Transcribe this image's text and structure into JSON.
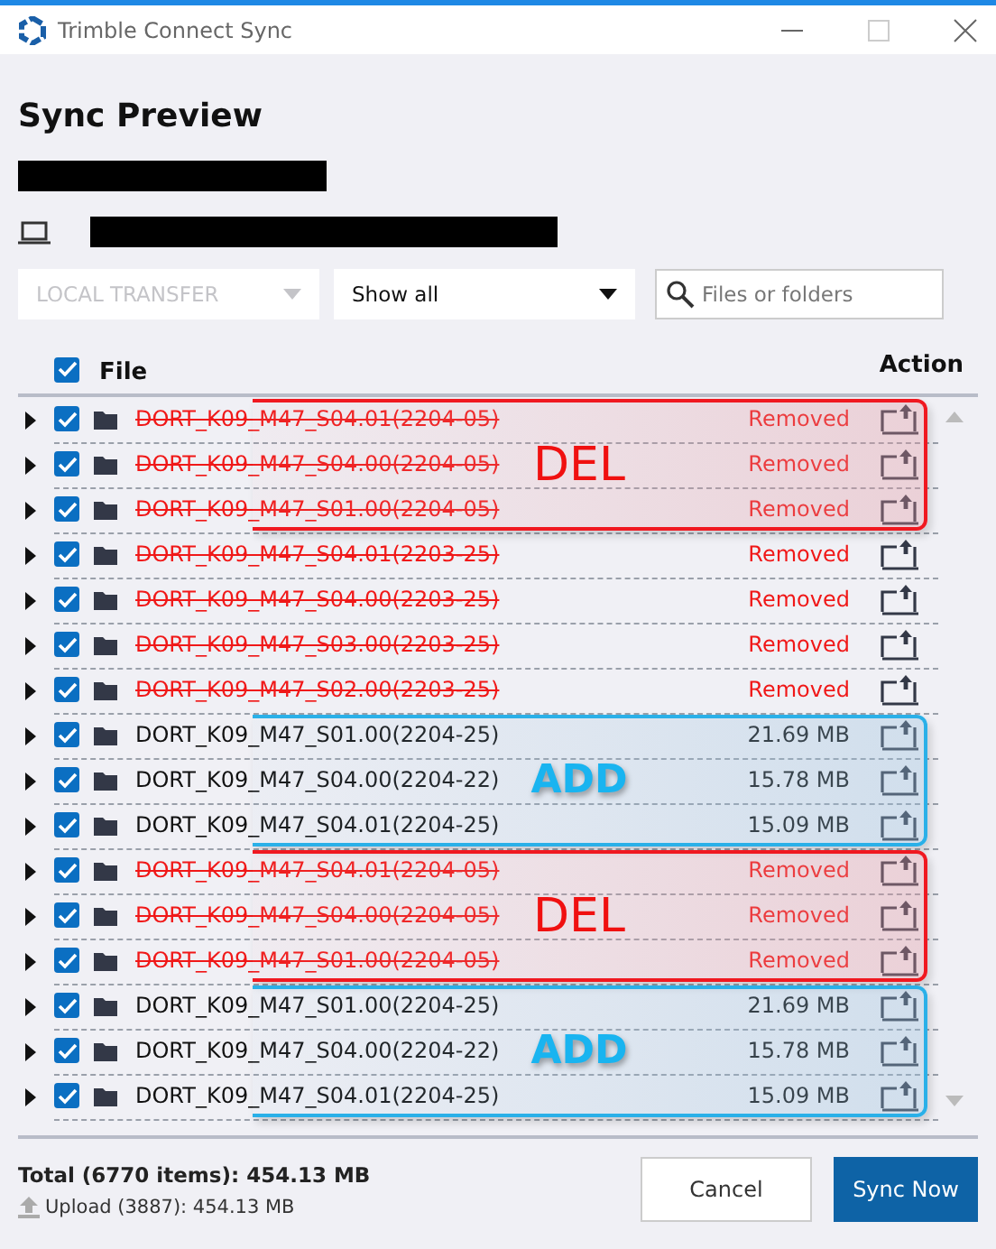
{
  "window": {
    "title": "Trimble Connect Sync"
  },
  "heading": "Sync Preview",
  "filters": {
    "transfer": {
      "label": "LOCAL TRANSFER",
      "disabled": true
    },
    "show": {
      "label": "Show all",
      "disabled": false
    },
    "search": {
      "placeholder": "Files or folders"
    }
  },
  "table": {
    "select_all": true,
    "columns": [
      "File",
      "Action"
    ],
    "groups": [
      {
        "kind": "del",
        "label": "DEL",
        "rows": [
          {
            "name": "DORT_K09_M47_S04.01(2204-05)",
            "status": "Removed",
            "removed": true,
            "checked": true
          },
          {
            "name": "DORT_K09_M47_S04.00(2204-05)",
            "status": "Removed",
            "removed": true,
            "checked": true
          },
          {
            "name": "DORT_K09_M47_S01.00(2204-05)",
            "status": "Removed",
            "removed": true,
            "checked": true
          }
        ]
      },
      {
        "kind": "none",
        "rows": [
          {
            "name": "DORT_K09_M47_S04.01(2203-25)",
            "status": "Removed",
            "removed": true,
            "checked": true
          },
          {
            "name": "DORT_K09_M47_S04.00(2203-25)",
            "status": "Removed",
            "removed": true,
            "checked": true
          },
          {
            "name": "DORT_K09_M47_S03.00(2203-25)",
            "status": "Removed",
            "removed": true,
            "checked": true
          },
          {
            "name": "DORT_K09_M47_S02.00(2203-25)",
            "status": "Removed",
            "removed": true,
            "checked": true
          }
        ]
      },
      {
        "kind": "add",
        "label": "ADD",
        "rows": [
          {
            "name": "DORT_K09_M47_S01.00(2204-25)",
            "status": "21.69 MB",
            "removed": false,
            "checked": true
          },
          {
            "name": "DORT_K09_M47_S04.00(2204-22)",
            "status": "15.78 MB",
            "removed": false,
            "checked": true
          },
          {
            "name": "DORT_K09_M47_S04.01(2204-25)",
            "status": "15.09 MB",
            "removed": false,
            "checked": true
          }
        ]
      },
      {
        "kind": "del",
        "label": "DEL",
        "rows": [
          {
            "name": "DORT_K09_M47_S04.01(2204-05)",
            "status": "Removed",
            "removed": true,
            "checked": true
          },
          {
            "name": "DORT_K09_M47_S04.00(2204-05)",
            "status": "Removed",
            "removed": true,
            "checked": true
          },
          {
            "name": "DORT_K09_M47_S01.00(2204-05)",
            "status": "Removed",
            "removed": true,
            "checked": true
          }
        ]
      },
      {
        "kind": "add",
        "label": "ADD",
        "rows": [
          {
            "name": "DORT_K09_M47_S01.00(2204-25)",
            "status": "21.69 MB",
            "removed": false,
            "checked": true
          },
          {
            "name": "DORT_K09_M47_S04.00(2204-22)",
            "status": "15.78 MB",
            "removed": false,
            "checked": true
          },
          {
            "name": "DORT_K09_M47_S04.01(2204-25)",
            "status": "15.09 MB",
            "removed": false,
            "checked": true
          }
        ]
      }
    ]
  },
  "footer": {
    "total": "Total (6770 items): 454.13 MB",
    "upload": "Upload (3887): 454.13 MB"
  },
  "buttons": [
    {
      "label": "Cancel",
      "kind": "secondary"
    },
    {
      "label": "Sync Now",
      "kind": "primary"
    }
  ]
}
